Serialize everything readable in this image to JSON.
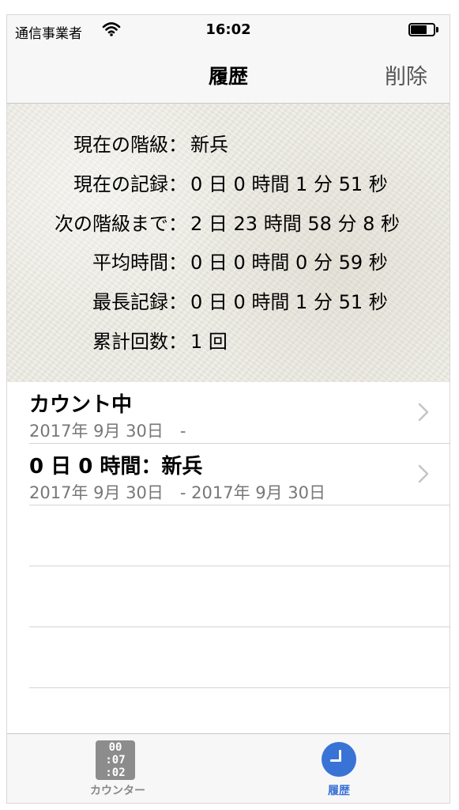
{
  "status_bar": {
    "carrier": "通信事業者",
    "time": "16:02"
  },
  "nav": {
    "title": "履歴",
    "delete_label": "削除"
  },
  "stats": [
    {
      "label": "現在の階級：",
      "value": "新兵"
    },
    {
      "label": "現在の記録：",
      "value": "0 日 0 時間 1 分 51 秒"
    },
    {
      "label": "次の階級まで：",
      "value": "2 日 23 時間 58 分 8 秒"
    },
    {
      "label": "平均時間：",
      "value": "0 日 0 時間 0 分 59 秒"
    },
    {
      "label": "最長記録：",
      "value": "0 日 0 時間 1 分 51 秒"
    },
    {
      "label": "累計回数：",
      "value": "1 回"
    }
  ],
  "history": [
    {
      "title": "カウント中",
      "dates": "2017年 9月 30日　-"
    },
    {
      "title": "0 日 0 時間：新兵",
      "dates": "2017年 9月 30日　- 2017年 9月 30日"
    }
  ],
  "tabs": [
    {
      "label": "カウンター",
      "icon": "counter-icon",
      "icon_text": [
        "00",
        ":07",
        ":02"
      ],
      "selected": false
    },
    {
      "label": "履歴",
      "icon": "clock-icon",
      "selected": true
    }
  ],
  "colors": {
    "accent": "#3a73d6",
    "tab_inactive": "#888888",
    "subtitle_gray": "#777777"
  }
}
